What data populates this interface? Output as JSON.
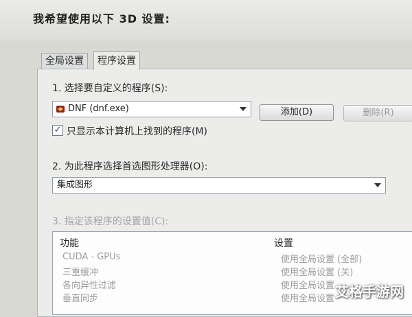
{
  "page": {
    "title": "我希望使用以下 3D 设置:"
  },
  "tabs": [
    {
      "label": "全局设置",
      "active": false
    },
    {
      "label": "程序设置",
      "active": true
    }
  ],
  "step1": {
    "label": "1. 选择要自定义的程序(S):",
    "selected_program": "DNF (dnf.exe)",
    "add_button": "添加(D)",
    "remove_button": "删除(R)",
    "checkbox_label": "只显示本计算机上找到的程序(M)",
    "checkbox_checked": true,
    "checkbox_mark": "✓"
  },
  "step2": {
    "label": "2. 为此程序选择首选图形处理器(O):",
    "selected_gpu": "集成图形"
  },
  "step3": {
    "label": "3. 指定该程序的设置值(C):",
    "columns": {
      "feature": "功能",
      "setting": "设置"
    },
    "rows": [
      {
        "feature": "CUDA - GPUs",
        "setting": "使用全局设置 (全部)"
      },
      {
        "feature": "三重缓冲",
        "setting": "使用全局设置 (关)"
      },
      {
        "feature": "各向异性过滤",
        "setting": "使用全局设置"
      },
      {
        "feature": "垂直同步",
        "setting": "使用全局设置"
      }
    ]
  },
  "watermark": "艾格手游网",
  "colors": {
    "accent": "#1c3d8a",
    "background": "#d9d9d4",
    "panel": "#ececea"
  }
}
